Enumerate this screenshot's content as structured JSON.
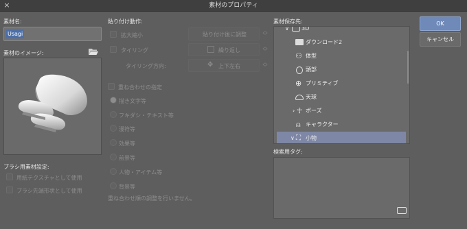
{
  "window": {
    "title": "素材のプロパティ",
    "close_icon": "×"
  },
  "left": {
    "name_label": "素材名:",
    "name_value": "Usagi",
    "image_label": "素材のイメージ:",
    "brush_section_label": "ブラシ用素材設定:",
    "brush_options": [
      "用紙テクスチャとして使用",
      "ブラシ先端形状として使用"
    ]
  },
  "paste": {
    "section_label": "貼り付け動作:",
    "scale_label": "拡大縮小",
    "scale_value": "貼り付け後に調整",
    "tiling_label": "タイリング",
    "tiling_value": "繰り返し",
    "tiling_dir_label": "タイリング方向:",
    "tiling_dir_value": "上下左右",
    "overlay_label": "重ね合わせの指定",
    "overlay_options": [
      "描き文字等",
      "フキダシ・テキスト等",
      "漫符等",
      "効果等",
      "前景等",
      "人物・アイテム等",
      "背景等"
    ],
    "overlay_note": "重ね合わせ順の調整を行いません。"
  },
  "storage": {
    "section_label": "素材保存先:",
    "items": [
      {
        "label": "3D",
        "icon": "3d-folder-icon",
        "expand": "∨"
      },
      {
        "label": "ダウンロード2",
        "icon": "folder-icon",
        "expand": ""
      },
      {
        "label": "体型",
        "icon": "body-type-icon",
        "expand": ""
      },
      {
        "label": "頭部",
        "icon": "head-icon",
        "expand": ""
      },
      {
        "label": "プリミティブ",
        "icon": "primitive-icon",
        "expand": ""
      },
      {
        "label": "天球",
        "icon": "sky-dome-icon",
        "expand": ""
      },
      {
        "label": "ポーズ",
        "icon": "pose-icon",
        "expand": "›"
      },
      {
        "label": "キャラクター",
        "icon": "character-icon",
        "expand": ""
      },
      {
        "label": "小物",
        "icon": "small-object-icon",
        "expand": "∨"
      }
    ],
    "selected_index": 8,
    "tag_label": "検索用タグ:"
  },
  "buttons": {
    "ok": "OK",
    "cancel": "キャンセル"
  },
  "colors": {
    "accent": "#6f8ab8",
    "selection": "#7f87a6",
    "background": "#5e5e5e"
  }
}
